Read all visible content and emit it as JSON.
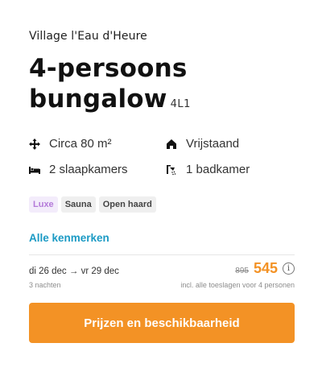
{
  "park_name": "Village l'Eau d'Heure",
  "title_line1": "4-persoons",
  "title_line2": "bungalow",
  "accommodation_code": "4L1",
  "features": [
    {
      "icon": "arrows-move-icon",
      "label": "Circa 80 m²"
    },
    {
      "icon": "house-icon",
      "label": "Vrijstaand"
    },
    {
      "icon": "bed-icon",
      "label": "2 slaapkamers"
    },
    {
      "icon": "shower-icon",
      "label": "1 badkamer"
    }
  ],
  "tags": [
    "Luxe",
    "Sauna",
    "Open haard"
  ],
  "all_features_link": "Alle kenmerken",
  "dates": "di 26 dec → vr 29 dec",
  "nights": "3 nachten",
  "price_old": "895",
  "price_new": "545",
  "info_symbol": "i",
  "price_note": "incl. alle toeslagen voor 4 personen",
  "cta_label": "Prijzen en beschikbaarheid",
  "colors": {
    "accent": "#f39225",
    "link": "#1b9ac4",
    "luxe_text": "#b47ad9",
    "luxe_bg": "#f3ecfb"
  }
}
